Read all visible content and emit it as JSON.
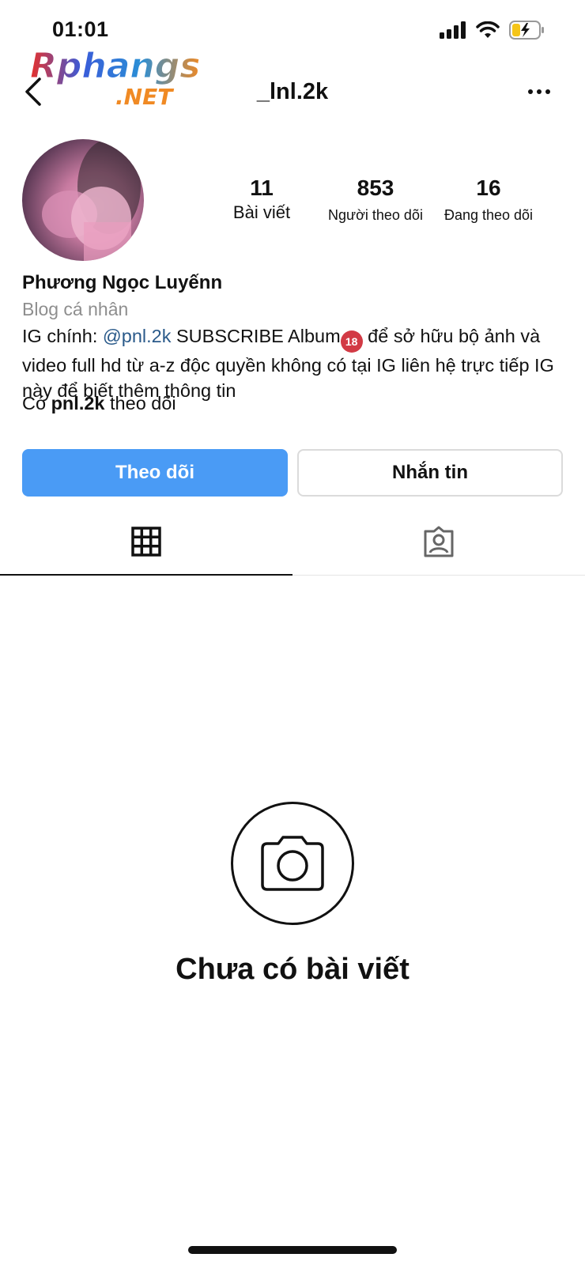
{
  "status_bar": {
    "time": "01:01"
  },
  "watermark": {
    "brand": "Rphangs",
    "suffix": ".NET"
  },
  "header": {
    "username": "_lnl.2k",
    "back_icon": "chevron-left-icon",
    "more_icon": "ellipsis-icon"
  },
  "stats": [
    {
      "value": "11",
      "label": "Bài viết"
    },
    {
      "value": "853",
      "label": "Người theo dõi"
    },
    {
      "value": "16",
      "label": "Đang theo dõi"
    }
  ],
  "profile": {
    "name": "Phương Ngọc Luyếnn",
    "category": "Blog cá nhân",
    "bio_prefix": "IG chính: ",
    "bio_mention": "@pnl.2k",
    "bio_middle": " SUBSCRIBE Album",
    "bio_emoji": "18",
    "bio_rest": " để sở hữu bộ ảnh và video full hd từ a-z độc quyền không có tại IG liên hệ trực tiếp IG này để biết thêm thông tin",
    "followed_by_prefix": "Có ",
    "followed_by_user": "pnl.2k",
    "followed_by_suffix": " theo dõi"
  },
  "actions": {
    "follow_label": "Theo dõi",
    "message_label": "Nhắn tin"
  },
  "tabs": [
    {
      "icon": "grid-icon",
      "active": true
    },
    {
      "icon": "tagged-icon",
      "active": false
    }
  ],
  "empty_state": {
    "icon": "camera-icon",
    "text": "Chưa có bài viết"
  },
  "colors": {
    "primary_button": "#4a9bf5",
    "mention": "#2a5a8a",
    "secondary_text": "#8e8e8e"
  }
}
